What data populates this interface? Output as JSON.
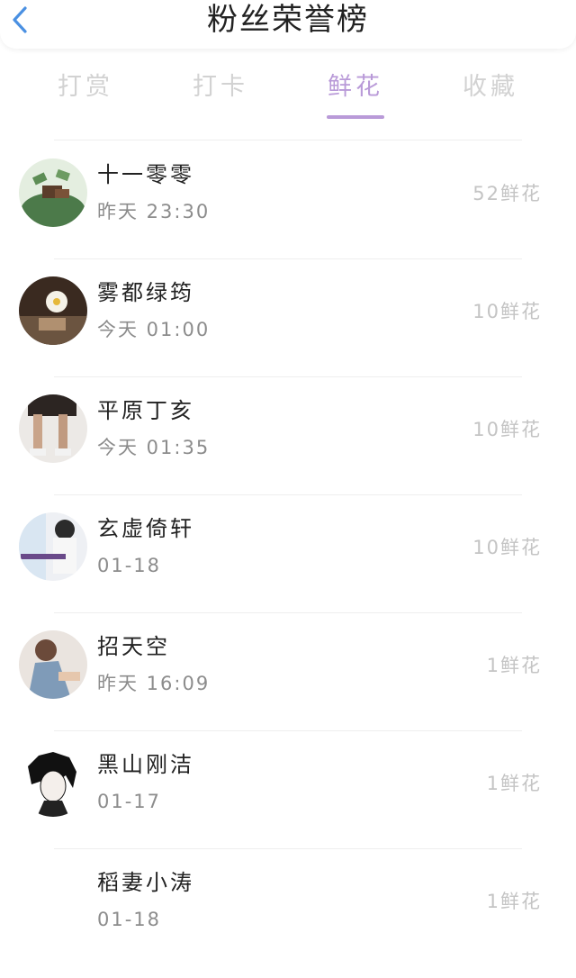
{
  "header": {
    "title": "粉丝荣誉榜",
    "back_icon": "chevron-left-icon",
    "accent_color": "#4a90e2"
  },
  "tabs": [
    {
      "label": "打赏",
      "active": false
    },
    {
      "label": "打卡",
      "active": false
    },
    {
      "label": "鲜花",
      "active": true
    },
    {
      "label": "收藏",
      "active": false
    }
  ],
  "colors": {
    "active_tab": "#b99ad8",
    "inactive_tab": "#d2d2d2",
    "amount": "#c4c4c4",
    "time": "#8c8c8c"
  },
  "fans": [
    {
      "name": "十一零零",
      "time": "昨天 23:30",
      "amount": "52鲜花"
    },
    {
      "name": "雾都绿筠",
      "time": "今天 01:00",
      "amount": "10鲜花"
    },
    {
      "name": "平原丁亥",
      "time": "今天 01:35",
      "amount": "10鲜花"
    },
    {
      "name": "玄虚倚轩",
      "time": "01-18",
      "amount": "10鲜花"
    },
    {
      "name": "招天空",
      "time": "昨天 16:09",
      "amount": "1鲜花"
    },
    {
      "name": "黑山刚洁",
      "time": "01-17",
      "amount": "1鲜花"
    },
    {
      "name": "稻妻小涛",
      "time": "01-18",
      "amount": "1鲜花"
    }
  ]
}
